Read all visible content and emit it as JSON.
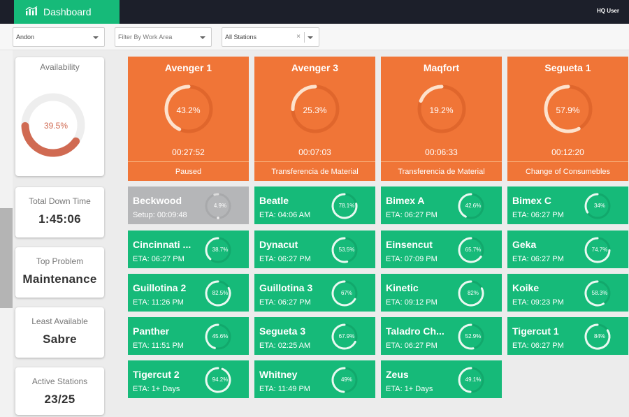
{
  "header": {
    "title": "Dashboard",
    "user": "HQ User"
  },
  "filters": {
    "view": "Andon",
    "work_area_placeholder": "Filter By Work Area",
    "stations": "All Stations",
    "clear_symbol": "×"
  },
  "summary": {
    "availability": {
      "label": "Availability",
      "value": "39.5%",
      "fraction": 0.395
    },
    "total_down_time": {
      "label": "Total Down Time",
      "value": "1:45:06"
    },
    "top_problem": {
      "label": "Top Problem",
      "value": "Maintenance"
    },
    "least_available": {
      "label": "Least Available",
      "value": "Sabre"
    },
    "active_stations": {
      "label": "Active Stations",
      "value": "23/25"
    }
  },
  "colors": {
    "down": "#f07537",
    "up": "#16ba79",
    "setup": "#b5b6b8",
    "brand": "#16ba79",
    "topbar": "#1c1f2a"
  },
  "down_stations": [
    {
      "name": "Avenger 1",
      "pct": "43.2%",
      "fraction": 0.432,
      "time": "00:27:52",
      "status": "Paused"
    },
    {
      "name": "Avenger 3",
      "pct": "25.3%",
      "fraction": 0.253,
      "time": "00:07:03",
      "status": "Transferencia de Material"
    },
    {
      "name": "Maqfort",
      "pct": "19.2%",
      "fraction": 0.192,
      "time": "00:06:33",
      "status": "Transferencia de Material"
    },
    {
      "name": "Segueta 1",
      "pct": "57.9%",
      "fraction": 0.579,
      "time": "00:12:20",
      "status": "Change of Consumebles"
    }
  ],
  "stations": [
    {
      "name": "Beckwood",
      "sub": "Setup: 00:09:48",
      "pct": "4.9%",
      "fraction": 0.049,
      "state": "setup"
    },
    {
      "name": "Beatle",
      "sub": "ETA: 04:06 AM",
      "pct": "78.1%",
      "fraction": 0.781,
      "state": "up"
    },
    {
      "name": "Bimex A",
      "sub": "ETA: 06:27 PM",
      "pct": "42.6%",
      "fraction": 0.426,
      "state": "up"
    },
    {
      "name": "Bimex C",
      "sub": "ETA: 06:27 PM",
      "pct": "34%",
      "fraction": 0.34,
      "state": "up"
    },
    {
      "name": "Cincinnati ...",
      "sub": "ETA: 06:27 PM",
      "pct": "38.7%",
      "fraction": 0.387,
      "state": "up"
    },
    {
      "name": "Dynacut",
      "sub": "ETA: 06:27 PM",
      "pct": "53.5%",
      "fraction": 0.535,
      "state": "up"
    },
    {
      "name": "Einsencut",
      "sub": "ETA: 07:09 PM",
      "pct": "65.7%",
      "fraction": 0.657,
      "state": "up"
    },
    {
      "name": "Geka",
      "sub": "ETA: 06:27 PM",
      "pct": "74.7%",
      "fraction": 0.747,
      "state": "up"
    },
    {
      "name": "Guillotina 2",
      "sub": "ETA: 11:26 PM",
      "pct": "82.5%",
      "fraction": 0.825,
      "state": "up"
    },
    {
      "name": "Guillotina 3",
      "sub": "ETA: 06:27 PM",
      "pct": "67%",
      "fraction": 0.67,
      "state": "up"
    },
    {
      "name": "Kinetic",
      "sub": "ETA: 09:12 PM",
      "pct": "82%",
      "fraction": 0.82,
      "state": "up"
    },
    {
      "name": "Koike",
      "sub": "ETA: 09:23 PM",
      "pct": "58.3%",
      "fraction": 0.583,
      "state": "up"
    },
    {
      "name": "Panther",
      "sub": "ETA: 11:51 PM",
      "pct": "45.6%",
      "fraction": 0.456,
      "state": "up"
    },
    {
      "name": "Segueta 3",
      "sub": "ETA: 02:25 AM",
      "pct": "67.9%",
      "fraction": 0.679,
      "state": "up"
    },
    {
      "name": "Taladro Ch...",
      "sub": "ETA: 06:27 PM",
      "pct": "52.9%",
      "fraction": 0.529,
      "state": "up"
    },
    {
      "name": "Tigercut 1",
      "sub": "ETA: 06:27 PM",
      "pct": "84%",
      "fraction": 0.84,
      "state": "up"
    },
    {
      "name": "Tigercut 2",
      "sub": "ETA: 1+ Days",
      "pct": "94.2%",
      "fraction": 0.942,
      "state": "up"
    },
    {
      "name": "Whitney",
      "sub": "ETA: 11:49 PM",
      "pct": "49%",
      "fraction": 0.49,
      "state": "up"
    },
    {
      "name": "Zeus",
      "sub": "ETA: 1+ Days",
      "pct": "49.1%",
      "fraction": 0.491,
      "state": "up"
    }
  ]
}
